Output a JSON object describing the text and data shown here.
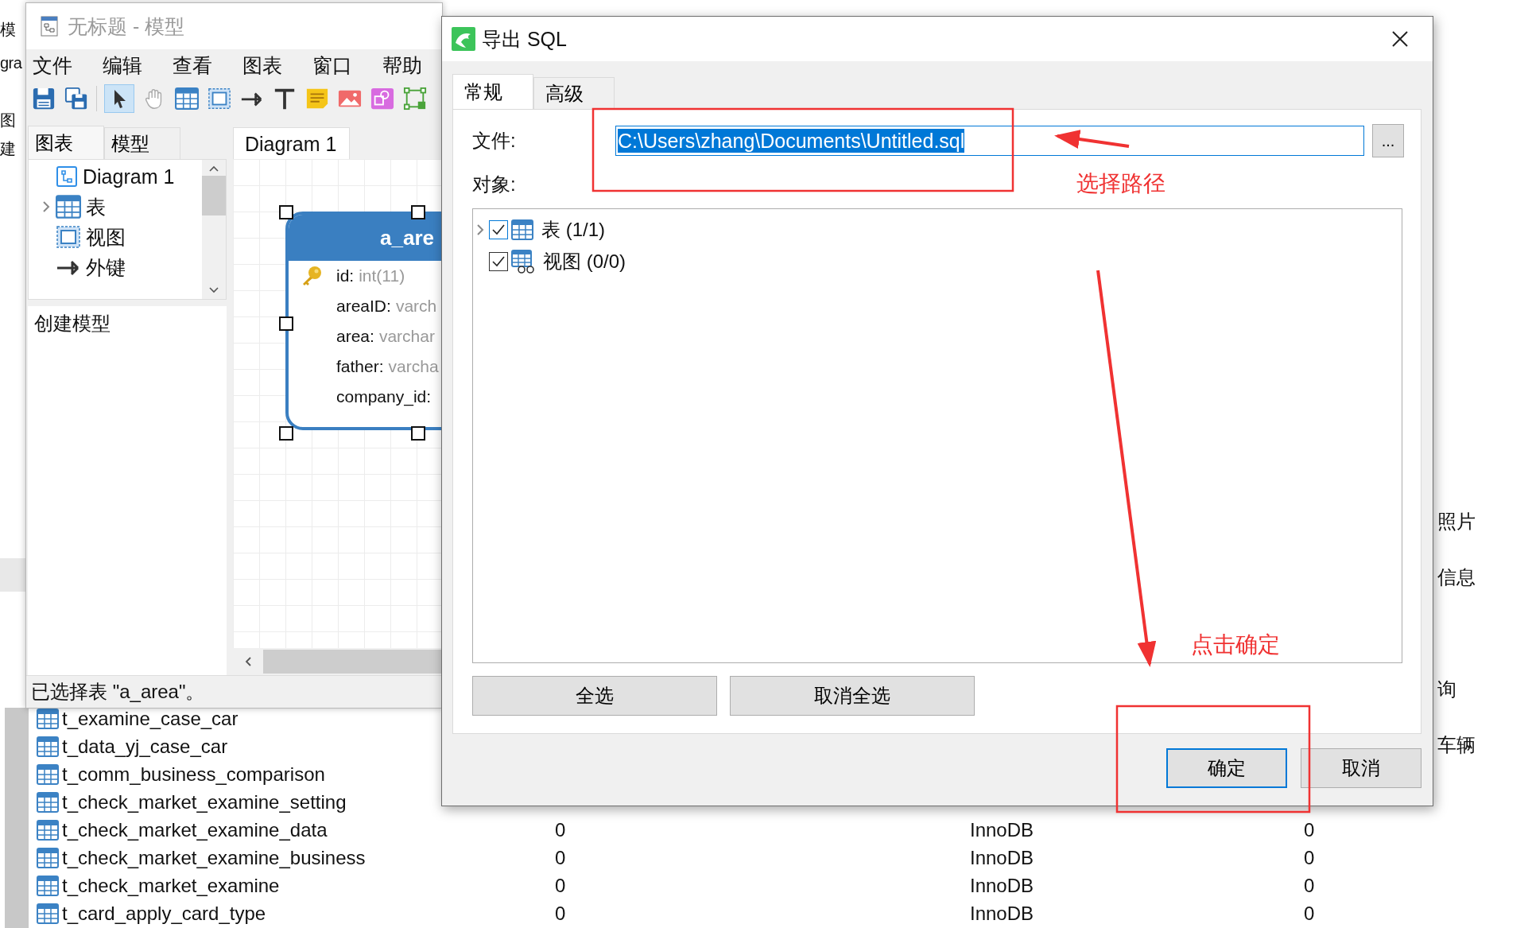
{
  "background": {
    "left_fragments": [
      "模",
      "gra",
      "图",
      "建"
    ],
    "right_fragments": [
      "照片",
      "信息",
      "询",
      "车辆"
    ],
    "table_rows": [
      {
        "name": "t_examine_case_car"
      },
      {
        "name": "t_data_yj_case_car"
      },
      {
        "name": "t_comm_business_comparison"
      },
      {
        "name": "t_check_market_examine_setting"
      },
      {
        "name": "t_check_market_examine_data",
        "cells": [
          "0",
          "InnoDB",
          "0"
        ]
      },
      {
        "name": "t_check_market_examine_business",
        "cells": [
          "0",
          "InnoDB",
          "0"
        ]
      },
      {
        "name": "t_check_market_examine",
        "cells": [
          "0",
          "InnoDB",
          "0"
        ]
      },
      {
        "name": "t_card_apply_card_type",
        "cells": [
          "0",
          "InnoDB",
          "0"
        ]
      }
    ]
  },
  "model_window": {
    "title": "无标题 - 模型",
    "menu": [
      "文件",
      "编辑",
      "查看",
      "图表",
      "窗口",
      "帮助"
    ],
    "toolbar": [
      {
        "kind": "save",
        "selected": false
      },
      {
        "kind": "save-all",
        "selected": false
      },
      {
        "kind": "pointer",
        "selected": true
      },
      {
        "kind": "hand",
        "selected": false
      },
      {
        "kind": "table",
        "selected": false
      },
      {
        "kind": "view",
        "selected": false
      },
      {
        "kind": "relation",
        "selected": false
      },
      {
        "kind": "text",
        "selected": false
      },
      {
        "kind": "note",
        "selected": false
      },
      {
        "kind": "image",
        "selected": false
      },
      {
        "kind": "shape",
        "selected": false
      },
      {
        "kind": "layout",
        "selected": false
      }
    ],
    "side_tabs": [
      {
        "label": "图表",
        "selected": true
      },
      {
        "label": "模型",
        "selected": false
      }
    ],
    "tree": [
      {
        "label": "Diagram 1",
        "kind": "diagram",
        "expandable": false
      },
      {
        "label": "表",
        "kind": "table",
        "expandable": true
      },
      {
        "label": "视图",
        "kind": "view",
        "expandable": false
      },
      {
        "label": "外键",
        "kind": "relation",
        "expandable": false
      }
    ],
    "info": "创建模型",
    "diagram_tab": "Diagram 1",
    "entity": {
      "name": "a_are",
      "fields": [
        {
          "name": "id:",
          "type": "int(11)",
          "key": true
        },
        {
          "name": "areaID:",
          "type": "varch",
          "key": false
        },
        {
          "name": "area:",
          "type": "varchar",
          "key": false
        },
        {
          "name": "father:",
          "type": "varcha",
          "key": false
        },
        {
          "name": "company_id:",
          "key": false
        }
      ]
    },
    "status": "已选择表 \"a_area\"。"
  },
  "export_dialog": {
    "title": "导出 SQL",
    "tabs": [
      {
        "label": "常规",
        "selected": true
      },
      {
        "label": "高级",
        "selected": false
      }
    ],
    "file_label": "文件:",
    "file_value": "C:\\Users\\zhang\\Documents\\Untitled.sql",
    "browse_button": "...",
    "objects_label": "对象:",
    "objects": [
      {
        "label": "表",
        "count": "(1/1)",
        "kind": "table",
        "checked": true,
        "expandable": true
      },
      {
        "label": "视图",
        "count": "(0/0)",
        "kind": "view",
        "checked": true,
        "expandable": false
      }
    ],
    "select_buttons": [
      "全选",
      "取消全选"
    ],
    "buttons": [
      {
        "label": "确定",
        "default": true
      },
      {
        "label": "取消",
        "default": false
      }
    ]
  },
  "annotations": {
    "path_note": "选择路径",
    "ok_note": "点击确定"
  }
}
